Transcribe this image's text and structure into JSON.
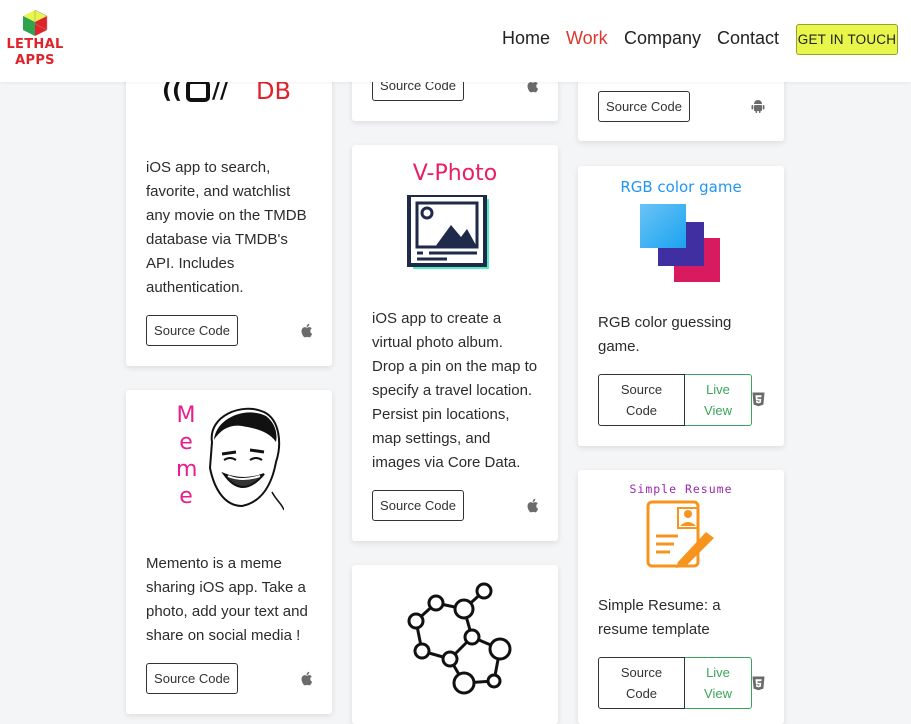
{
  "brand": {
    "line1": "LETHAL",
    "line2": "APPS"
  },
  "nav": {
    "home": "Home",
    "work": "Work",
    "company": "Company",
    "contact": "Contact",
    "cta": "GET IN TOUCH"
  },
  "colors": {
    "accent_red": "#d93a2f",
    "cta_yellow": "#e8f54a",
    "live_green": "#3aa55a"
  },
  "cards": {
    "tmdb": {
      "logo_text": "DB",
      "description": [
        "iOS app to search,",
        "favorite, and watchlist",
        "any movie on the TMDB",
        "database via TMDB's",
        "API. Includes",
        "authentication."
      ],
      "source": "Source Code",
      "platform_icon": "apple-icon"
    },
    "top_middle": {
      "source": "Source Code",
      "platform_icon": "apple-icon"
    },
    "top_right": {
      "source": "Source Code",
      "platform_icon": "android-icon"
    },
    "vphoto": {
      "logo_text": "V-Photo",
      "description": [
        "iOS app to create a",
        "virtual photo album.",
        "Drop a pin on the map to",
        "specify a travel location.",
        "Persist pin locations,",
        "map settings, and",
        "images via Core Data."
      ],
      "source": "Source Code",
      "platform_icon": "apple-icon"
    },
    "rgb": {
      "logo_text": "RGB color game",
      "description": [
        "RGB color guessing",
        "game."
      ],
      "source_line1": "Source",
      "source_line2": "Code",
      "live_line1": "Live",
      "live_line2": "View",
      "platform_icon": "html5-icon"
    },
    "meme": {
      "logo_letters": [
        "M",
        "e",
        "m",
        "e"
      ],
      "description": [
        "Memento is a meme",
        "sharing iOS app. Take a",
        "photo, add your text and",
        "share on social media !"
      ],
      "source": "Source Code",
      "platform_icon": "apple-icon"
    },
    "resume": {
      "logo_text": "Simple Resume",
      "description": [
        "Simple Resume: a",
        "resume template"
      ],
      "source_line1": "Source",
      "source_line2": "Code",
      "live_line1": "Live",
      "live_line2": "View",
      "platform_icon": "html5-icon"
    },
    "molecule": {
      "platform_icon": "molecule-icon"
    }
  }
}
